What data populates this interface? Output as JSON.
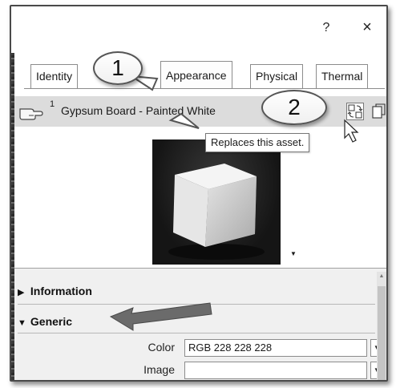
{
  "window": {
    "help_label": "?",
    "close_label": "×"
  },
  "tabs": [
    {
      "label": "Identity",
      "active": false
    },
    {
      "label": "Appearance",
      "active": true
    },
    {
      "label": "Physical",
      "active": false
    },
    {
      "label": "Thermal",
      "active": false
    }
  ],
  "asset": {
    "count": "1",
    "name": "Gypsum Board - Painted White",
    "replace_icon": "replace-asset-icon",
    "duplicate_icon": "duplicate-asset-icon"
  },
  "tooltip": {
    "text": "Replaces this asset."
  },
  "preview": {
    "icon": "material-preview-cube"
  },
  "properties": {
    "information_label": "Information",
    "generic_label": "Generic",
    "color_label": "Color",
    "color_value": "RGB 228 228 228",
    "image_label": "Image",
    "image_value": ""
  },
  "callouts": {
    "one": "1",
    "two": "2"
  },
  "colors": {
    "asset_bar": "#dcdcdc",
    "panel": "#f0f0f0",
    "arrow": "#6b6b6b"
  }
}
